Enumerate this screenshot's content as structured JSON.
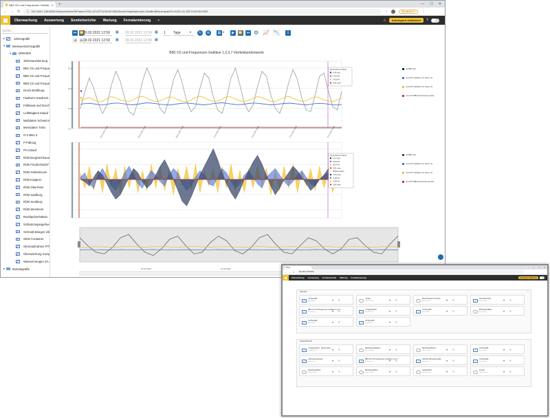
{
  "main_window": {
    "tab_title": "BB2 O2 und Frequenzen Gebläs...",
    "new_tab": "+",
    "url": "192.168.1.246:5051/Users/archive/96?start=2021-02-20T11:59:00.000Z&unit=Days&amount=1&diff=diff&compareTo=2021-02-18T11:59:00.000Z",
    "nav": [
      "Überwachung",
      "Auswertung",
      "Sonderberichte",
      "Wartung",
      "Fernalarmierung"
    ],
    "autologout": "Autologout deaktiviert",
    "sidebar_search": "Suche...",
    "sidebar": [
      {
        "label": "Jahresgrafik",
        "kind": "chart",
        "indent": 0
      },
      {
        "label": "Messwertarchivgrafik",
        "kind": "folder",
        "indent": 0
      },
      {
        "label": "DREHER",
        "kind": "folder",
        "indent": 1
      },
      {
        "label": "Jahresauswertung",
        "kind": "chart",
        "indent": 2
      },
      {
        "label": "BB1 O2 und Frequenz...",
        "kind": "chart",
        "indent": 2
      },
      {
        "label": "BB2 O2 und Frequenz...",
        "kind": "chart",
        "indent": 2
      },
      {
        "label": "BB3 O2 und Frequenz...",
        "kind": "chart",
        "indent": 2
      },
      {
        "label": "Druck Belüftung",
        "kind": "chart",
        "indent": 2
      },
      {
        "label": "Faulturm Gasdruck",
        "kind": "chart",
        "indent": 2
      },
      {
        "label": "Füllstand und Durchfl...",
        "kind": "chart",
        "indent": 2
      },
      {
        "label": "Leitfähigkeit Zulauf",
        "kind": "chart",
        "indent": 2
      },
      {
        "label": "Meßdaten Schwimme...",
        "kind": "chart",
        "indent": 2
      },
      {
        "label": "Messdaten Trafo",
        "kind": "chart",
        "indent": 2
      },
      {
        "label": "O-2 BB1-3",
        "kind": "chart",
        "indent": 2
      },
      {
        "label": "P-Fällung",
        "kind": "chart",
        "indent": 2
      },
      {
        "label": "PH Zulauf",
        "kind": "chart",
        "indent": 2
      },
      {
        "label": "RÜB Burghöchhausen",
        "kind": "chart",
        "indent": 2
      },
      {
        "label": "RÜB Friedrichsdorf",
        "kind": "chart",
        "indent": 2
      },
      {
        "label": "RÜB Grafenbrunn",
        "kind": "chart",
        "indent": 2
      },
      {
        "label": "RÜB Köppern",
        "kind": "chart",
        "indent": 2
      },
      {
        "label": "RÜB Oberrhein",
        "kind": "chart",
        "indent": 2
      },
      {
        "label": "RÜB Saalburg",
        "kind": "chart",
        "indent": 2
      },
      {
        "label": "RÜB Seulberg",
        "kind": "chart",
        "indent": 2
      },
      {
        "label": "RÜB Weinheim",
        "kind": "chart",
        "indent": 2
      },
      {
        "label": "Rücklaufverhältnis",
        "kind": "chart",
        "indent": 2
      },
      {
        "label": "Schlammspiegelmess...",
        "kind": "chart",
        "indent": 2
      },
      {
        "label": "Schmidt Brieges Über...",
        "kind": "chart",
        "indent": 2
      },
      {
        "label": "SEW Container",
        "kind": "chart",
        "indent": 2
      },
      {
        "label": "Stromaufnahme PTM...",
        "kind": "chart",
        "indent": 2
      },
      {
        "label": "Überwachung Kompr...",
        "kind": "chart",
        "indent": 2
      },
      {
        "label": "Wassermengen ZA / ...",
        "kind": "chart",
        "indent": 2
      },
      {
        "label": "Monatsgrafik",
        "kind": "folder",
        "indent": 0
      }
    ],
    "toolbar": {
      "date_from_1": "20.02.2021 12:59",
      "date_to_1": "20.02.2021 12:59",
      "date_from_2": "18.02.2021 12:59",
      "date_to_2": "18.02.2021 12:59",
      "amount": "1",
      "unit": "Tage"
    }
  },
  "chart_data": [
    {
      "type": "line",
      "title": "BB2 O2 und Frequenzen Gebläse 1,2,3,7  Viertelstundenwerte",
      "series": [
        {
          "name": "O2 BB2 mg/l",
          "color": "#1f2a44",
          "values": []
        },
        {
          "name": "+K11.4T3 Gebläse 1 Ist Frequ. Hz",
          "color": "#4a6fd8",
          "values": [
            14.5,
            14.8,
            15.0,
            14.7,
            14.2,
            14.0,
            14.4,
            14.9,
            15.2,
            15.0,
            14.6,
            14.3,
            14.1,
            14.5,
            14.9,
            15.3,
            15.1,
            14.8,
            14.4,
            14.2,
            14.0,
            14.3,
            14.7,
            15.0,
            15.2,
            14.9,
            14.6,
            14.3,
            14.1,
            14.4,
            14.8,
            15.1,
            15.3,
            15.0,
            14.6,
            14.3,
            14.2,
            14.5,
            14.9,
            15.2,
            15.0,
            14.7,
            14.4,
            14.1,
            14.3,
            14.6,
            14.9,
            15.1,
            14.9,
            14.6,
            14.3,
            14.1,
            14.4,
            14.8,
            15.0,
            14.8,
            14.5,
            14.2,
            14.0,
            14.3
          ]
        },
        {
          "name": "+K11.4T3 Gebläse 2 Ist Frequ. Hz",
          "color": "#f2c12e",
          "values": [
            16.5,
            17.5,
            18.5,
            17.0,
            16.0,
            16.2,
            17.8,
            19.0,
            18.2,
            17.0,
            16.3,
            16.0,
            17.2,
            18.6,
            19.2,
            18.0,
            16.8,
            16.0,
            16.4,
            17.6,
            18.8,
            18.4,
            17.2,
            16.2,
            16.0,
            17.0,
            18.5,
            19.3,
            18.3,
            17.0,
            16.1,
            16.3,
            17.5,
            18.9,
            18.8,
            17.5,
            16.5,
            16.0,
            16.8,
            18.0,
            19.0,
            18.4,
            17.1,
            16.2,
            16.1,
            17.2,
            18.6,
            19.1,
            18.0,
            16.9,
            16.2,
            16.5,
            17.8,
            18.9,
            18.2,
            17.0,
            16.3,
            16.1,
            17.0,
            18.1
          ]
        },
        {
          "name": "+K11.4T3 BB2 Druckmessung mbar",
          "color": "#c0392b",
          "values": []
        }
      ],
      "y_ticks": [
        "30.0",
        "20.0",
        "10.0",
        "0.0"
      ],
      "x_ticks": [
        "20.02.2021 15:00",
        "20.02.2021 18:00",
        "20.02.2021 21:00",
        "21.02.2021 00:00",
        "21.02.2021 03:00",
        "21.02.2021 06:00",
        "21.02.2021 09:00"
      ],
      "tooltip": {
        "time": "20.02.2021 07:45:00",
        "rows": [
          "4,04 mg/l",
          "13,00 Hz",
          "14,00 Hz",
          "0,00 mbar"
        ]
      },
      "gray_values": [
        12,
        22,
        30,
        24,
        15,
        9,
        14,
        26,
        34,
        28,
        18,
        10,
        8,
        16,
        28,
        36,
        30,
        20,
        12,
        9,
        17,
        29,
        35,
        27,
        16,
        10,
        13,
        24,
        33,
        30,
        19,
        11,
        9,
        18,
        30,
        36,
        26,
        15,
        10,
        14,
        25,
        34,
        31,
        20,
        12,
        9,
        16,
        27,
        35,
        29,
        18,
        11,
        10,
        20,
        31,
        33,
        22,
        13,
        11,
        22
      ]
    },
    {
      "type": "area",
      "title": "",
      "series": [
        {
          "name": "O2 BB2 mg/l",
          "color": "#3b4a6b",
          "values": [
            0,
            -1,
            -3,
            1,
            4,
            2,
            -2,
            -6,
            -9,
            -7,
            -3,
            1,
            5,
            3,
            -1,
            -4,
            -2,
            2,
            6,
            9,
            5,
            0,
            -5,
            -10,
            -12,
            -8,
            -3,
            2,
            6,
            10,
            14,
            9,
            3,
            -2,
            -6,
            -9,
            -5,
            0,
            4,
            8,
            11,
            7,
            2,
            -3,
            -7,
            -4,
            0,
            3,
            6,
            4,
            1,
            -2,
            -5,
            -3,
            0,
            2,
            5,
            3,
            0,
            -1
          ]
        },
        {
          "name": "+K11.4T3 Gebläse 1 Ist Frequ. Hz",
          "color": "#4a6fd8",
          "values": [
            1,
            3,
            -2,
            -4,
            2,
            5,
            1,
            -3,
            -5,
            -1,
            3,
            6,
            2,
            -2,
            -4,
            1,
            4,
            2,
            -1,
            -3,
            2,
            5,
            3,
            -2,
            -5,
            -3,
            1,
            4,
            2,
            -2,
            -3,
            1,
            5,
            3,
            -1,
            -4,
            -2,
            2,
            4,
            1,
            -2,
            -4,
            1,
            3,
            5,
            2,
            -1,
            -3,
            -1,
            2,
            4,
            1,
            -2,
            -3,
            0,
            2,
            3,
            1,
            -1,
            -2
          ]
        },
        {
          "name": "+K11.4T3 Gebläse 2 Ist Frequ. Hz",
          "color": "#f2c12e",
          "values": [
            3,
            -4,
            6,
            -5,
            4,
            -6,
            7,
            -3,
            5,
            -7,
            6,
            -4,
            5,
            -6,
            4,
            -5,
            7,
            -4,
            6,
            -5,
            4,
            -7,
            5,
            -3,
            6,
            -5,
            7,
            -6,
            4,
            -3,
            5,
            -6,
            6,
            -4,
            7,
            -5,
            4,
            -6,
            5,
            -4,
            6,
            -3,
            5,
            -7,
            4,
            -5,
            6,
            -4,
            7,
            -6,
            4,
            -3,
            5,
            -5,
            6,
            -4,
            3,
            -6,
            5,
            -3
          ]
        },
        {
          "name": "+K11.4T3 BB2 Druckmessung mbar",
          "color": "#c0392b",
          "values": []
        }
      ],
      "tooltip": {
        "time": "19.02.2021 07:45:00",
        "rows": [
          "4,17 mg/l",
          "15,00 Hz",
          "20,00 Hz",
          "0,00 mbar",
          "Differenzwerte",
          "-0,13 mg/l",
          "-2,00 Hz",
          "-6,00 Hz",
          "0,00 mbar"
        ]
      }
    },
    {
      "type": "line",
      "title": "Navigator",
      "x_ticks": [
        "20.02.2021",
        "21.02.2021"
      ],
      "series": [
        {
          "name": "",
          "color": "#555",
          "values": [
            30,
            20,
            12,
            10,
            18,
            30,
            34,
            22,
            12,
            8,
            16,
            28,
            32,
            20,
            10,
            12,
            24,
            32,
            26,
            14,
            10,
            18,
            30,
            34,
            22,
            12,
            10,
            20,
            30,
            26,
            16,
            10,
            16,
            28,
            30,
            20,
            12,
            10,
            22,
            32
          ]
        },
        {
          "name": "",
          "color": "#f2c12e",
          "values": [
            18,
            18.5,
            19,
            18.6,
            18.2,
            18.8,
            19.2,
            18.7,
            18.3,
            18.9,
            19.1,
            18.6,
            18.2,
            18.8,
            19.3,
            18.7,
            18.3,
            18.9,
            19.0,
            18.5,
            18.2,
            18.8,
            19.2,
            18.6,
            18.3,
            18.9,
            19.1,
            18.5,
            18.2,
            18.8,
            19.2,
            18.7,
            18.3,
            18.9,
            19.0,
            18.6,
            18.3,
            18.8,
            19.1,
            18.6
          ]
        },
        {
          "name": "",
          "color": "#4a6fd8",
          "values": [
            15,
            15.2,
            15.1,
            14.9,
            15.0,
            15.2,
            15.1,
            14.9,
            15.0,
            15.3,
            15.1,
            14.9,
            15.0,
            15.2,
            15.0,
            14.9,
            15.1,
            15.3,
            15.0,
            14.9,
            15.1,
            15.2,
            15.0,
            14.9,
            15.0,
            15.2,
            15.1,
            14.9,
            15.0,
            15.3,
            15.1,
            14.9,
            15.0,
            15.2,
            15.0,
            14.9,
            15.1,
            15.2,
            15.0,
            14.9
          ]
        }
      ]
    }
  ],
  "second_window": {
    "tab_title": "Dibex",
    "url": "192.168.1.246:5051",
    "nav": [
      "Überwachung",
      "Auswertung",
      "Sonderberichte",
      "Wartung",
      "Fernalarmierung"
    ],
    "autologout": "Autologout deaktiviert",
    "favoriten_title": "Favoriten",
    "zuletzt_title": "Zuletzt Besucht",
    "favoriten": [
      {
        "t": "Archivgrafik",
        "s": "Auswertung",
        "i": "chart"
      },
      {
        "t": "Lüngel",
        "s": "Überwachung",
        "i": "cloud"
      },
      {
        "t": "Brauchwasser Prozess",
        "s": "Überwachung",
        "i": "cloud"
      },
      {
        "t": "Stromkennlinie",
        "s": "Auswertung",
        "i": "chart"
      },
      {
        "t": "BB1 O2 und Frequenzen Gebläse 1,2,3,7",
        "s": "Auswertung",
        "i": "chart"
      },
      {
        "t": "1 Tagesbericht",
        "s": "Sonderbericht",
        "i": "chart"
      },
      {
        "t": "Archivgrafik",
        "s": "Auswertung",
        "i": "chart"
      },
      {
        "t": "Betriebsgrafiken",
        "s": "Auswertung",
        "i": "cloud"
      },
      {
        "t": "Archivgrafik",
        "s": "Auswertung",
        "i": "chart"
      },
      {
        "t": "Archivgrafik",
        "s": "Auswertung",
        "i": "chart"
      }
    ],
    "zuletzt": [
      {
        "t": "1 Tagesbericht - Monat 2021",
        "s": "Sonderbericht",
        "i": "chart"
      },
      {
        "t": "Meßdatengrafiken2",
        "s": "Überwachung",
        "i": "cloud"
      },
      {
        "t": "Betriebsgrafiken1",
        "s": "Überwachung",
        "i": "cloud"
      },
      {
        "t": "Archivgrafik",
        "s": "Auswertung",
        "i": "chart"
      },
      {
        "t": "Jahresauswertung",
        "s": "Auswertung",
        "i": "chart"
      },
      {
        "t": "BB1 O2 und Frequenzen Gebläse 1,2,3,7",
        "s": "Auswertung",
        "i": "chart"
      },
      {
        "t": "Aktuelle Messwertgrafik",
        "s": "Auswertung",
        "i": "chart"
      },
      {
        "t": "Archivgrafik",
        "s": "Auswertung",
        "i": "chart"
      },
      {
        "t": "Betriebsgrafiken",
        "s": "Überwachung",
        "i": "cloud"
      },
      {
        "t": "Betriebsgrafiken",
        "s": "Überwachung",
        "i": "cloud"
      },
      {
        "t": "Gasgebläse",
        "s": "Überwachung",
        "i": "cloud"
      },
      {
        "t": "Lüngel",
        "s": "Überwachung",
        "i": "cloud"
      }
    ]
  }
}
